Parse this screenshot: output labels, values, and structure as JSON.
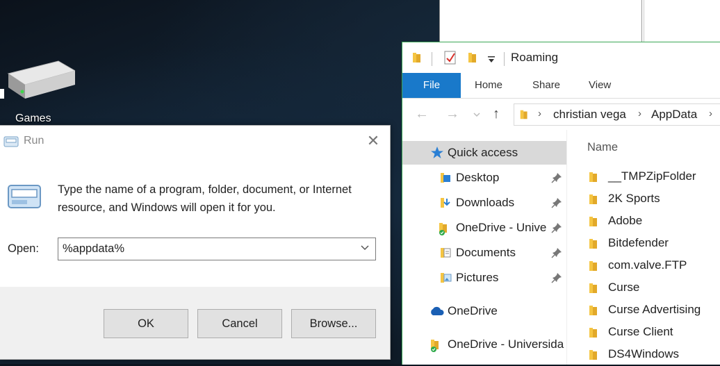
{
  "desktop": {
    "icon_label": "Games"
  },
  "run_dialog": {
    "title": "Run",
    "description": "Type the name of a program, folder, document, or Internet resource, and Windows will open it for you.",
    "open_label": "Open:",
    "open_value": "%appdata%",
    "ok_label": "OK",
    "cancel_label": "Cancel",
    "browse_label": "Browse..."
  },
  "explorer": {
    "window_title": "Roaming",
    "ribbon_tabs": [
      "File",
      "Home",
      "Share",
      "View"
    ],
    "breadcrumb": [
      "christian vega",
      "AppData"
    ],
    "column_header": "Name",
    "nav_items": [
      {
        "label": "Quick access",
        "icon": "star-icon"
      },
      {
        "label": "Desktop",
        "icon": "desktop-folder-icon"
      },
      {
        "label": "Downloads",
        "icon": "downloads-folder-icon"
      },
      {
        "label": "OneDrive - Unive",
        "icon": "onedrive-folder-icon"
      },
      {
        "label": "Documents",
        "icon": "documents-folder-icon"
      },
      {
        "label": "Pictures",
        "icon": "pictures-folder-icon"
      },
      {
        "label": "OneDrive",
        "icon": "cloud-icon"
      },
      {
        "label": "OneDrive - Universida",
        "icon": "onedrive-folder-icon"
      }
    ],
    "files": [
      "__TMPZipFolder",
      "2K Sports",
      "Adobe",
      "Bitdefender",
      "com.valve.FTP",
      "Curse",
      "Curse Advertising",
      "Curse Client",
      "DS4Windows"
    ],
    "colors": {
      "accent": "#1979ca",
      "folder": "#f5c542"
    }
  }
}
